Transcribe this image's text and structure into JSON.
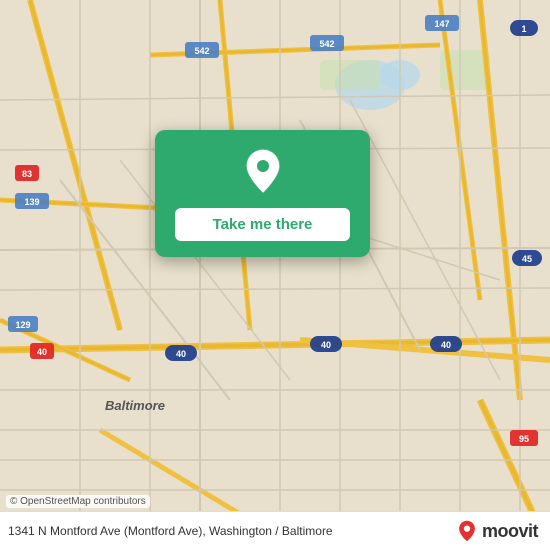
{
  "map": {
    "bg_color": "#e0d8c8",
    "attribution": "© OpenStreetMap contributors"
  },
  "popup": {
    "button_label": "Take me there",
    "pin_icon": "location-pin"
  },
  "bottom_bar": {
    "address": "1341 N Montford Ave (Montford Ave), Washington / Baltimore",
    "brand_name": "moovit"
  }
}
